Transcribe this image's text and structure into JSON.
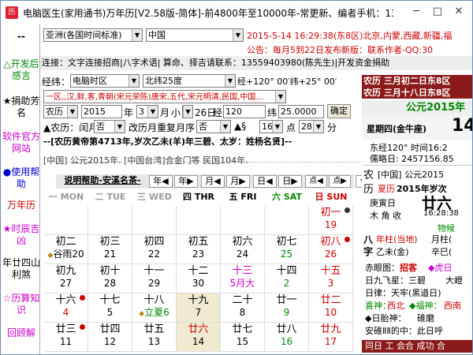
{
  "window": {
    "title": "电脑医生(家用通书)万年历[V2.58版-简体]-前4800年至10000年-常更新、编者手机：1355...",
    "app_icon": "历"
  },
  "left_nav": [
    "△开发后感言",
    "★捐助芳名",
    "软件官方网站",
    "●使用帮助",
    "万年历",
    "★时辰吉凶",
    "年廿四山利煞",
    "☆历算知识",
    "回顾解"
  ],
  "toolbar": {
    "timezone": "亚洲(各国时间标准)",
    "country": "中国",
    "datetime": "2015-5-14  16:29:38(东8区)北京,内蒙,西藏,新疆,福",
    "notice": "公告：每月5到22日发布新版：联系作者-QQ:30",
    "links": "连接：文字连接招商|八字术语| 算命、择吉请联系：13559403980(陈先生)|开发资金捐助",
    "jingdu_label": "经纬：",
    "jingdu_select": "电脑时区",
    "beiwei_select": "北纬25度",
    "jingdu_value": "经+120° 00′纬+25° 00′",
    "city_select": "一区,,汉,鲜,客,青朝(宋元荣陈)唐宋,五代,宋元明清,民国,中国...",
    "calendar_type": "农历",
    "year": "2015",
    "year_unit": "年",
    "month": "3",
    "month_unit": "月",
    "month_flag": "小",
    "day_prefix": "26日",
    "jing_label": "经",
    "jing_value": "120",
    "wei_label": "纬",
    "wei_value": "25.0000",
    "confirm": "确定"
  },
  "leap_row": {
    "a": "▲农历：闰月",
    "a_sel": "否",
    "b": "改历月重复月序",
    "b_sel": "否",
    "c": "▲§",
    "hour_sel": "16",
    "c_unit": "点",
    "min_sel": "28",
    "min_unit": "分"
  },
  "info_line": "--[农历黄帝第4713年,岁次乙未(羊)年三碧、太岁：姓杨名贤]--",
  "region_line": "[中国] 公元2015年. [中国台湾]合金门等 民国104年.",
  "nav": {
    "help": "说明帮助-安溪名茶-",
    "year_prev": "年◀",
    "year_next": "年▶",
    "month_prev": "月◀",
    "month_next": "月▶",
    "day_prev": "日◀",
    "day_next": "日▶",
    "point_prev": "点◀",
    "point_next": "点▶",
    "today": "今"
  },
  "weekdays": [
    {
      "cn": "一",
      "en": "MON",
      "color": "#999999"
    },
    {
      "cn": "二",
      "en": "TUE",
      "color": "#999999"
    },
    {
      "cn": "三",
      "en": "WED",
      "color": "#999999"
    },
    {
      "cn": "四",
      "en": "THR",
      "color": "#000000"
    },
    {
      "cn": "五",
      "en": "FRI",
      "color": "#000000"
    },
    {
      "cn": "六",
      "en": "SAT",
      "color": "#008800"
    },
    {
      "cn": "日",
      "en": "SUN",
      "color": "#cc0000"
    }
  ],
  "calendar": [
    [
      null,
      null,
      null,
      null,
      null,
      null,
      {
        "cn": "初一",
        "gd": "19",
        "cc": "#cc0000",
        "gc": "#cc0000",
        "dot": "#333"
      }
    ],
    [
      {
        "cn": "初二",
        "gd": "谷雨20",
        "cc": "#000",
        "gc": "#000",
        "mark": "◆"
      },
      {
        "cn": "初三",
        "gd": "21"
      },
      {
        "cn": "初四",
        "gd": "22"
      },
      {
        "cn": "初五",
        "gd": "23"
      },
      {
        "cn": "初六",
        "gd": "24"
      },
      {
        "cn": "初七",
        "gd": "25",
        "gc": "#008800"
      },
      {
        "cn": "初八",
        "gd": "26",
        "cc": "#cc0000",
        "gc": "#cc0000",
        "moon": true
      }
    ],
    [
      {
        "cn": "初九",
        "gd": "27"
      },
      {
        "cn": "初十",
        "gd": "28"
      },
      {
        "cn": "十一",
        "gd": "29"
      },
      {
        "cn": "十二",
        "gd": "30"
      },
      {
        "cn": "十三",
        "gd": "5月大",
        "cc": "#cc00cc",
        "gc": "#cc00cc"
      },
      {
        "cn": "十四",
        "gd": "2",
        "gc": "#008800"
      },
      {
        "cn": "十五",
        "gd": "3",
        "cc": "#cc0000",
        "gc": "#cc0000"
      }
    ],
    [
      {
        "cn": "十六",
        "gd": "4",
        "gc": "#cc0000",
        "moon": true
      },
      {
        "cn": "十七",
        "gd": "5"
      },
      {
        "cn": "十八",
        "gd": "立夏6",
        "mark": "◆",
        "gc": "#008800"
      },
      {
        "cn": "十九",
        "gd": "7",
        "bg": "#f0ead0"
      },
      {
        "cn": "二十",
        "gd": "8"
      },
      {
        "cn": "廿一",
        "gd": "9",
        "gc": "#008800"
      },
      {
        "cn": "廿二",
        "gd": "10",
        "cc": "#cc0000",
        "gc": "#cc0000"
      }
    ],
    [
      {
        "cn": "廿三",
        "gd": "11",
        "moon": true
      },
      {
        "cn": "廿四",
        "gd": "12"
      },
      {
        "cn": "廿五",
        "gd": "13"
      },
      {
        "cn": "廿六",
        "gd": "14",
        "bg": "#f0ead0",
        "cc": "#cc0000"
      },
      {
        "cn": "廿七",
        "gd": "15"
      },
      {
        "cn": "廿八",
        "gd": "16",
        "gc": "#008800"
      },
      {
        "cn": "廿九",
        "gd": "17",
        "cc": "#cc0000",
        "gc": "#cc0000"
      }
    ]
  ],
  "right_panel": {
    "nl1": "农历  三月初二日东8区",
    "nl2": "农历  三月十八日东8区",
    "gongyuan": "公元2015年",
    "week": "星期四(金牛座)",
    "big_day": "14",
    "dongjing": "东经120° 时间16:2",
    "julian": "儒略日:  2457156.85",
    "nongli_label": "农",
    "nongli_text": "[中国] 公元2015",
    "li_label": "历",
    "xiali": "夏历",
    "xiali_text": "2015年岁次",
    "gengyin": "庚寅日",
    "muxiang": "木 角 收",
    "liu": "廿六",
    "time": "16:28:38",
    "wuhou": "物候",
    "bazi1": "八",
    "bazi2": "字",
    "nianzhu": "年柱(当地)",
    "yuezhu": "月柱(",
    "yiwei": "乙未(金)",
    "xinsi": "辛巳(",
    "chimai": "赤眼图：",
    "zhaoxing": "招客",
    "huzhi": "◆虎日",
    "rijiu": "日九飞星：三碧",
    "dajie": "大嶝",
    "rilv": "日律：天牢(黑道日)",
    "xishen": "喜神：",
    "xibei": "西北",
    "fushen": "◆福神：",
    "xinan": "西南",
    "jiutai": "◆日胎神：",
    "dizhu": "碓磨",
    "anjing": "安碓ⅡⅡ的中：此日呼",
    "bottom": "同日 工 会合 成功 合"
  }
}
